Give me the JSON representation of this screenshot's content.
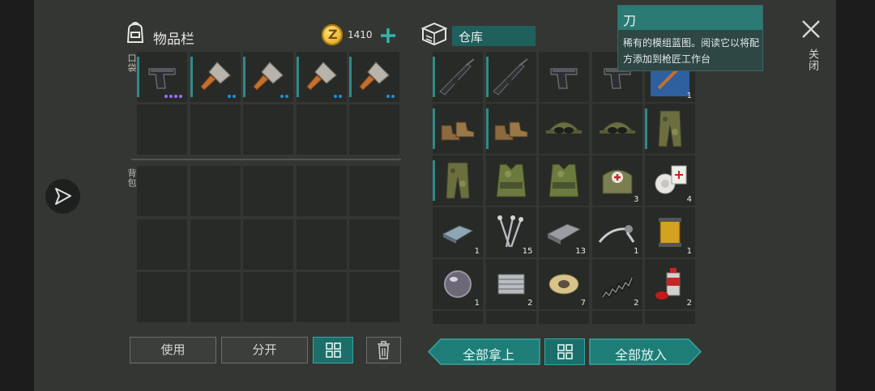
{
  "inventory": {
    "title": "物品栏",
    "coins": "1410",
    "pocket_label": "口袋",
    "backpack_label": "背包",
    "pocket_items": [
      {
        "icon": "pistol-icon",
        "dots": [
          "#9b6bff",
          "#9b6bff",
          "#9b6bff",
          "#9b6bff"
        ]
      },
      {
        "icon": "cleaver-icon",
        "dots": [
          "#1d8fd6",
          "#1d8fd6"
        ]
      },
      {
        "icon": "cleaver-icon",
        "dots": [
          "#1d8fd6",
          "#1d8fd6"
        ]
      },
      {
        "icon": "cleaver-icon",
        "dots": [
          "#1d8fd6",
          "#1d8fd6"
        ]
      },
      {
        "icon": "cleaver-icon",
        "dots": [
          "#1d8fd6",
          "#1d8fd6"
        ]
      }
    ],
    "use_label": "使用",
    "split_label": "分开"
  },
  "storage": {
    "title": "仓库",
    "take_all_label": "全部拿上",
    "put_all_label": "全部放入",
    "items": [
      {
        "icon": "assault-rifle-icon",
        "count": "",
        "bar": true
      },
      {
        "icon": "assault-rifle-icon",
        "count": "",
        "bar": true
      },
      {
        "icon": "pistol-icon",
        "count": "",
        "bar": false
      },
      {
        "icon": "pistol-icon",
        "count": "",
        "bar": false
      },
      {
        "icon": "blueprint-icon",
        "count": "1",
        "bar": false
      },
      {
        "icon": "boots-icon",
        "count": "",
        "bar": true
      },
      {
        "icon": "boots-icon",
        "count": "",
        "bar": true
      },
      {
        "icon": "cap-with-goggles-icon",
        "count": "",
        "bar": false
      },
      {
        "icon": "cap-with-goggles-icon",
        "count": "",
        "bar": false
      },
      {
        "icon": "camo-pants-icon",
        "count": "",
        "bar": true
      },
      {
        "icon": "camo-pants-icon",
        "count": "",
        "bar": true
      },
      {
        "icon": "camo-vest-icon",
        "count": "",
        "bar": false
      },
      {
        "icon": "camo-vest-icon",
        "count": "",
        "bar": false
      },
      {
        "icon": "medkit-bag-icon",
        "count": "3",
        "bar": false
      },
      {
        "icon": "bandage-icon",
        "count": "4",
        "bar": false
      },
      {
        "icon": "metal-ingot-icon",
        "count": "1",
        "bar": false
      },
      {
        "icon": "nails-icon",
        "count": "15",
        "bar": false
      },
      {
        "icon": "steel-bar-icon",
        "count": "13",
        "bar": false
      },
      {
        "icon": "brake-lever-icon",
        "count": "1",
        "bar": false
      },
      {
        "icon": "oil-filter-icon",
        "count": "1",
        "bar": false
      },
      {
        "icon": "glass-lens-icon",
        "count": "1",
        "bar": false
      },
      {
        "icon": "engine-part-icon",
        "count": "2",
        "bar": false
      },
      {
        "icon": "wire-spool-icon",
        "count": "7",
        "bar": false
      },
      {
        "icon": "spring-icon",
        "count": "2",
        "bar": false
      },
      {
        "icon": "spray-can-icon",
        "count": "2",
        "bar": false
      }
    ]
  },
  "tooltip": {
    "title": "刀",
    "description": "稀有的模组蓝图。阅读它以将配方添加到枪匠工作台"
  },
  "close_label": "关闭"
}
